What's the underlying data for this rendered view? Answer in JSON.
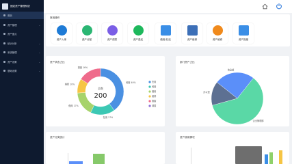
{
  "app": {
    "title": "固定资产管理系统"
  },
  "sidebar": {
    "items": [
      {
        "label": "首页",
        "active": true
      },
      {
        "label": "资产管理"
      },
      {
        "label": "资产盘点"
      },
      {
        "label": "统计分析"
      },
      {
        "label": "系统管理"
      },
      {
        "label": "资产设置"
      },
      {
        "label": "基础设置"
      }
    ]
  },
  "common": {
    "title": "常用操作",
    "tiles": [
      {
        "label": "资产入库",
        "icon": "import-icon",
        "color": "#1e7bd6"
      },
      {
        "label": "资产分配",
        "icon": "assign-icon",
        "color": "#2bb673"
      },
      {
        "label": "资产调拨",
        "icon": "transfer-icon",
        "color": "#7a5ee6"
      },
      {
        "label": "资产退还",
        "icon": "return-icon",
        "color": "#1eb85c"
      },
      {
        "label": "借用/归还",
        "icon": "borrow-icon",
        "color": "#3a8ee6"
      },
      {
        "label": "资产维修",
        "icon": "repair-icon",
        "color": "#3c6fb7"
      },
      {
        "label": "资产维修",
        "icon": "wrench-icon",
        "color": "#f08a1c"
      },
      {
        "label": "资产报废",
        "icon": "trash-icon",
        "color": "#3a8ee6"
      }
    ]
  },
  "status_card": {
    "title": "资产状态占比",
    "center_label": "总数",
    "center_value": "200"
  },
  "dept_card": {
    "title": "部门资产占比"
  },
  "category_card": {
    "title": "资产分类统计"
  },
  "usage_card": {
    "title": "资产使用情况"
  },
  "chart_data": [
    {
      "type": "pie",
      "title": "资产状态占比",
      "slices": [
        {
          "label": "闲置",
          "value": 40,
          "color": "#4a90e2"
        },
        {
          "label": "在用",
          "value": 17,
          "color": "#3cc8b4"
        },
        {
          "label": "借用",
          "value": 17,
          "color": "#a7d36b"
        },
        {
          "label": "维修",
          "value": 10,
          "color": "#f6c544"
        },
        {
          "label": "报废",
          "value": 16,
          "color": "#ef6b8b"
        }
      ],
      "data_labels": [
        "闲置 40%",
        "在用 17%",
        "借用 17%",
        "维修 10%",
        "报废 16%"
      ],
      "legend": [
        "在用",
        "闲置",
        "借用",
        "维修",
        "报废",
        "调拨"
      ],
      "legend_colors": [
        "#4a90e2",
        "#3cc8b4",
        "#a7d36b",
        "#f6c544",
        "#ef6b8b",
        "#8e70d6"
      ],
      "legend_position": "right"
    },
    {
      "type": "pie",
      "title": "部门资产占比",
      "slices": [
        {
          "label": "信息部",
          "value": 25,
          "color": "#5b8ff9"
        },
        {
          "label": "企业管理部",
          "value": 60,
          "color": "#5ad8a6"
        },
        {
          "label": "办公室",
          "value": 15,
          "color": "#5d7092"
        }
      ],
      "data_labels": [
        "信息部",
        "企业管理部",
        "办公室"
      ],
      "legend_position": "top-left"
    }
  ]
}
